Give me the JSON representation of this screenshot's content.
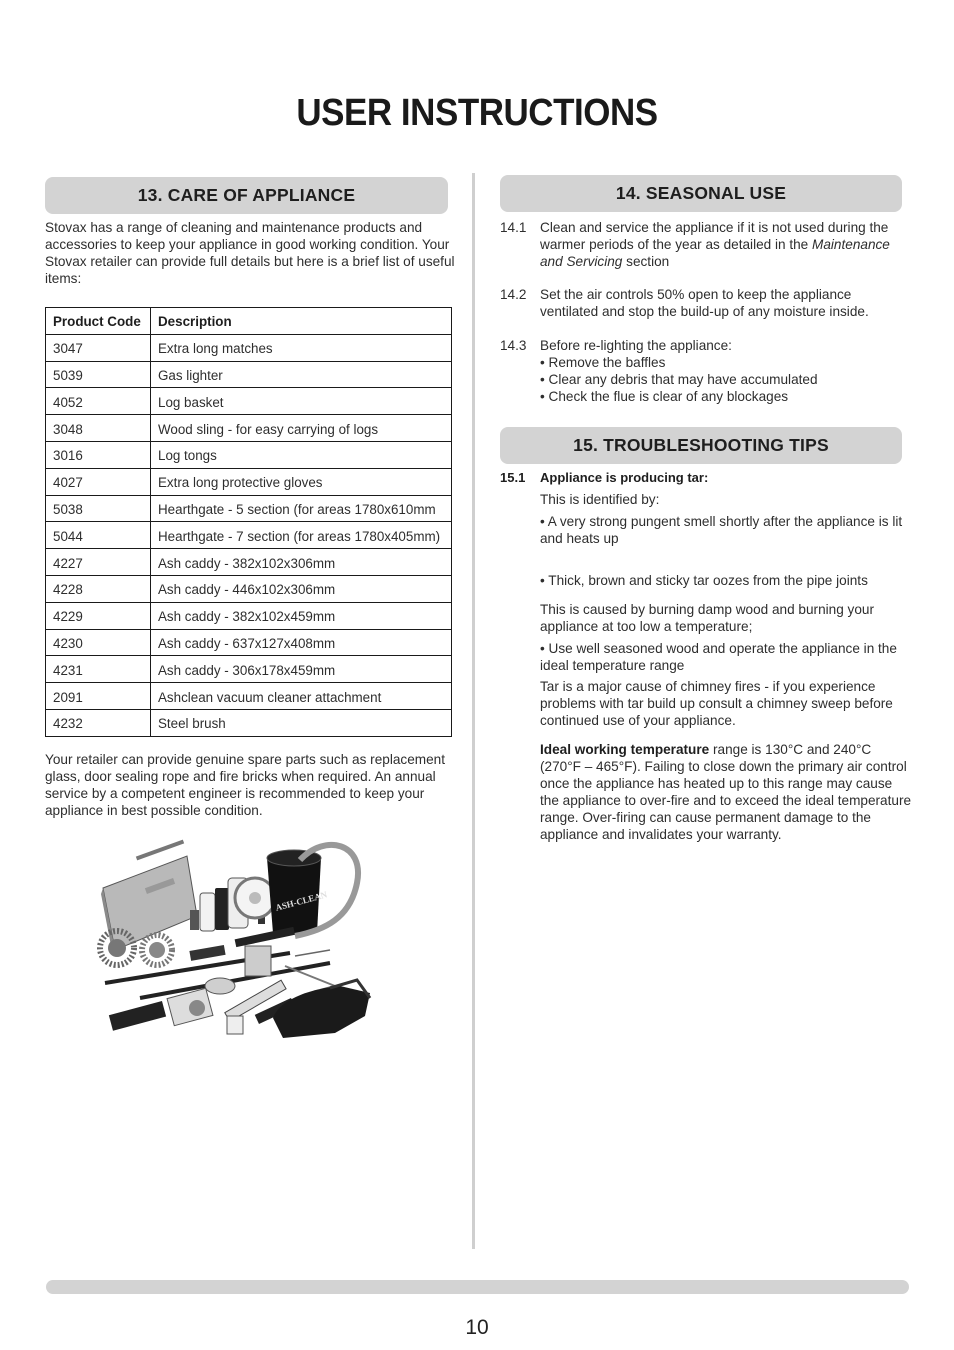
{
  "page": {
    "title": "USER INSTRUCTIONS",
    "page_number": "10"
  },
  "care": {
    "heading": "13. CARE OF APPLIANCE",
    "intro": "Stovax has a range of cleaning and maintenance products and accessories to keep your appliance in good working condition. Your Stovax retailer can provide full details but here is a brief list of useful items:",
    "table": {
      "headers": [
        "Product Code",
        "Description"
      ],
      "rows": [
        [
          "3047",
          "Extra long matches"
        ],
        [
          "5039",
          "Gas lighter"
        ],
        [
          "4052",
          "Log basket"
        ],
        [
          "3048",
          "Wood sling - for easy carrying of logs"
        ],
        [
          "3016",
          "Log tongs"
        ],
        [
          "4027",
          "Extra long protective gloves"
        ],
        [
          "5038",
          "Hearthgate - 5 section (for areas 1780x610mm"
        ],
        [
          "5044",
          "Hearthgate - 7 section (for areas 1780x405mm)"
        ],
        [
          "4227",
          "Ash caddy - 382x102x306mm"
        ],
        [
          "4228",
          "Ash caddy - 446x102x306mm"
        ],
        [
          "4229",
          "Ash caddy - 382x102x459mm"
        ],
        [
          "4230",
          "Ash caddy - 637x127x408mm"
        ],
        [
          "4231",
          "Ash caddy - 306x178x459mm"
        ],
        [
          "2091",
          "Ashclean vacuum cleaner attachment"
        ],
        [
          "4232",
          "Steel brush"
        ]
      ]
    },
    "retailer_text": "Your retailer can provide genuine spare parts such as replacement glass, door sealing rope and fire bricks when required. An annual service by a competent engineer is recommended to keep your appliance in best possible condition.",
    "photo_label": "ASH-CLEAN"
  },
  "seasonal": {
    "heading": "14. SEASONAL USE",
    "items": [
      {
        "num": "14.1",
        "text_before": "Clean and service the appliance if it is not used during the warmer periods of the year as detailed in the ",
        "text_italic": "Maintenance and Servicing",
        "text_after": " section"
      },
      {
        "num": "14.2",
        "text": "Set the air controls 50% open to keep the appliance ventilated and stop the build-up of any moisture inside."
      },
      {
        "num": "14.3",
        "text": "Before re-lighting the appliance:",
        "bullets": [
          "• Remove the baffles",
          "• Clear any debris that may have accumulated",
          "• Check the flue is clear of any blockages"
        ]
      }
    ]
  },
  "troubleshooting": {
    "heading": "15. TROUBLESHOOTING TIPS",
    "item_num": "15.1",
    "item_title": "Appliance is producing tar:",
    "identified": "This is identified by:",
    "symptom_1": "• A very strong pungent smell shortly after the appliance is lit and heats up",
    "symptom_2": "• Thick, brown and sticky tar oozes from the pipe joints",
    "cause": "This is caused by burning damp wood and burning your appliance at too low a temperature;",
    "remedy": "• Use well seasoned wood and operate the appliance in the ideal temperature range",
    "warning": "Tar is a major cause of chimney fires - if you experience problems with tar build up consult a chimney sweep before continued use of your appliance.",
    "ideal_label": "Ideal working temperature",
    "ideal_text": " range is 130°C and 240°C (270°F – 465°F). Failing to close down the primary air control once the appliance has heated up to this range may cause the appliance to over-fire and to exceed the ideal temperature range. Over-firing can cause permanent damage to the appliance and invalidates your warranty."
  }
}
